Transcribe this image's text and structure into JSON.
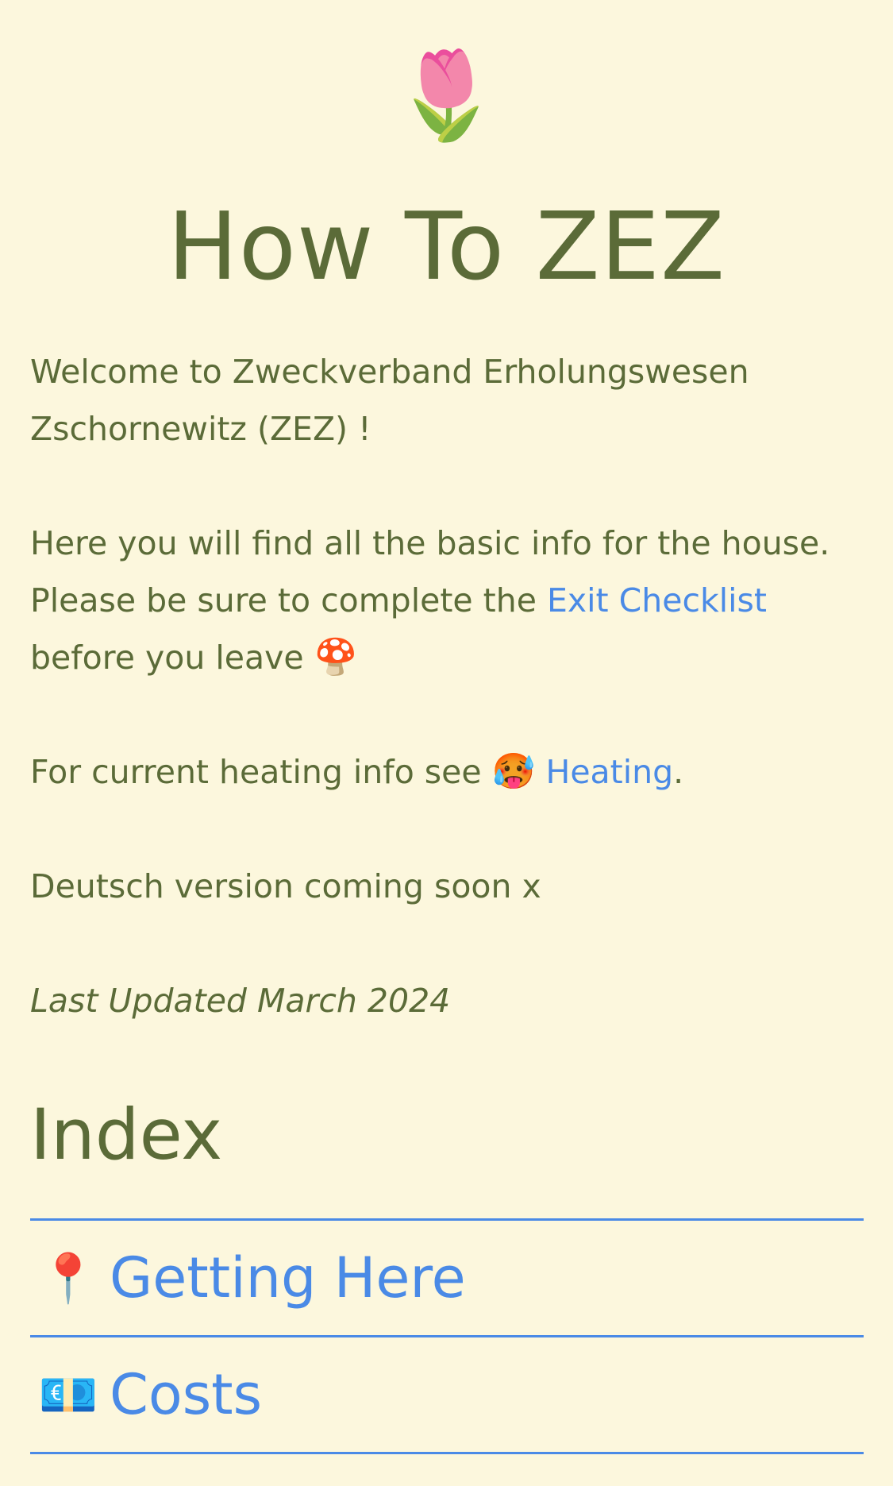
{
  "header": {
    "hero_emoji": "🌷",
    "title": "How To ZEZ"
  },
  "intro": {
    "welcome": "Welcome to Zweckverband Erholungswesen Zschornewitz (ZEZ) !",
    "info_line_start": "Here you will find all the basic info for the house. Please be sure to complete the ",
    "exit_checklist_link": "Exit Checklist",
    "info_line_end": " before you leave ",
    "mushroom_emoji": "🍄",
    "heating_start": "For current heating info see ",
    "hot_face_emoji": "🥵",
    "heating_link": "Heating",
    "heating_end": ".",
    "deutsch_note": "Deutsch version coming soon x",
    "last_updated": "Last Updated March 2024"
  },
  "index": {
    "heading": "Index",
    "items": [
      {
        "icon": "📍",
        "icon_name": "round-pushpin-icon",
        "label": "Getting Here"
      },
      {
        "icon": "💶",
        "icon_name": "euro-banknote-icon",
        "label": "Costs"
      }
    ]
  },
  "colors": {
    "background": "#fcf7dd",
    "text": "#5b6b38",
    "link": "#4a8ae6"
  }
}
